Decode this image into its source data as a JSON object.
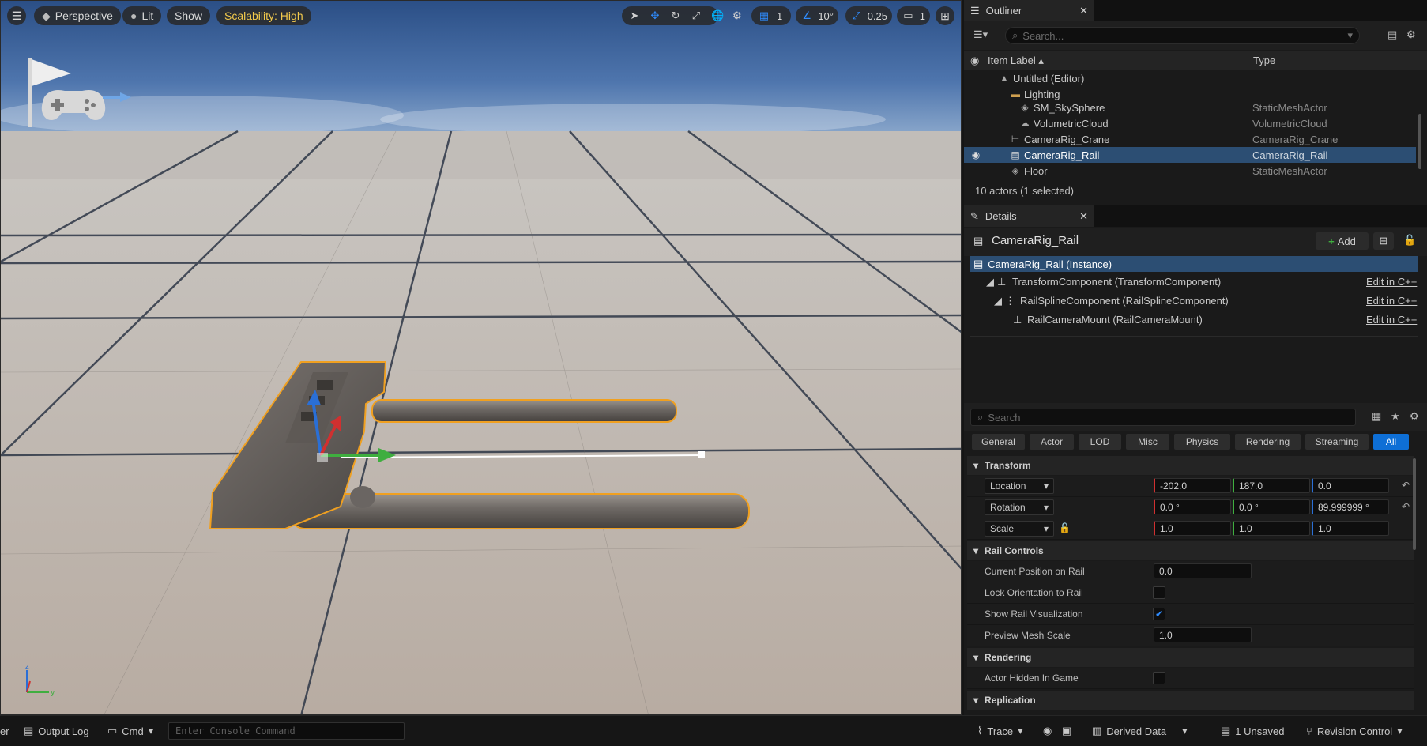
{
  "viewport": {
    "perspective_label": "Perspective",
    "lit_label": "Lit",
    "show_label": "Show",
    "scalability_label": "Scalability: High",
    "grid_snap_value": "1",
    "angle_snap_value": "10°",
    "scale_snap_value": "0.25",
    "camera_speed_value": "1"
  },
  "outliner": {
    "tab_title": "Outliner",
    "search_placeholder": "Search...",
    "col_label": "Item Label",
    "col_type": "Type",
    "items": [
      {
        "label": "Untitled (Editor)",
        "type": ""
      },
      {
        "label": "Lighting",
        "type": ""
      },
      {
        "label": "SM_SkySphere",
        "type": "StaticMeshActor"
      },
      {
        "label": "VolumetricCloud",
        "type": "VolumetricCloud"
      },
      {
        "label": "CameraRig_Crane",
        "type": "CameraRig_Crane"
      },
      {
        "label": "CameraRig_Rail",
        "type": "CameraRig_Rail"
      },
      {
        "label": "Floor",
        "type": "StaticMeshActor"
      }
    ],
    "status": "10 actors (1 selected)"
  },
  "details": {
    "tab_title": "Details",
    "actor_name": "CameraRig_Rail",
    "add_label": "Add",
    "components": [
      {
        "label": "CameraRig_Rail (Instance)",
        "edit": ""
      },
      {
        "label": "TransformComponent (TransformComponent)",
        "edit": "Edit in C++"
      },
      {
        "label": "RailSplineComponent (RailSplineComponent)",
        "edit": "Edit in C++"
      },
      {
        "label": "RailCameraMount (RailCameraMount)",
        "edit": "Edit in C++"
      }
    ],
    "search_placeholder": "Search",
    "categories": [
      "General",
      "Actor",
      "LOD",
      "Misc",
      "Physics",
      "Rendering",
      "Streaming",
      "All"
    ],
    "transform": {
      "section": "Transform",
      "location_label": "Location",
      "rotation_label": "Rotation",
      "scale_label": "Scale",
      "location": [
        "-202.0",
        "187.0",
        "0.0"
      ],
      "rotation": [
        "0.0 °",
        "0.0 °",
        "89.999999 °"
      ],
      "scale": [
        "1.0",
        "1.0",
        "1.0"
      ]
    },
    "rail_controls": {
      "section": "Rail Controls",
      "current_position_label": "Current Position on Rail",
      "current_position": "0.0",
      "lock_orientation_label": "Lock Orientation to Rail",
      "show_rail_label": "Show Rail Visualization",
      "preview_mesh_label": "Preview Mesh Scale",
      "preview_mesh_scale": "1.0"
    },
    "rendering": {
      "section": "Rendering",
      "hidden_label": "Actor Hidden In Game"
    },
    "replication": {
      "section": "Replication"
    }
  },
  "bottombar": {
    "left_fragment": "er",
    "output_log": "Output Log",
    "cmd": "Cmd",
    "console_placeholder": "Enter Console Command",
    "trace": "Trace",
    "derived_data": "Derived Data",
    "unsaved": "1 Unsaved",
    "revision_control": "Revision Control"
  },
  "colors": {
    "accent": "#0e6fd6",
    "selection": "#2c4e73",
    "scalability": "#f2c94c",
    "outline": "#f0a020"
  }
}
